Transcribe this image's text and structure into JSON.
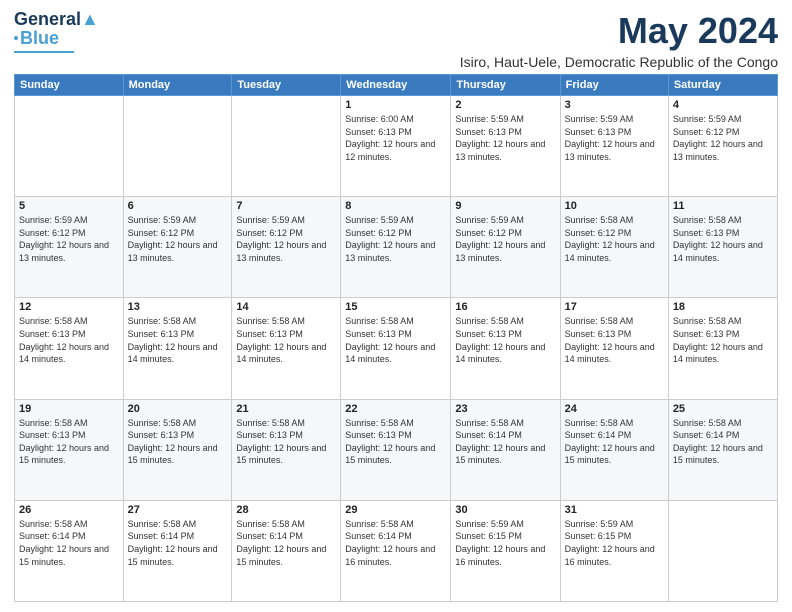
{
  "logo": {
    "line1": "General",
    "line2": "Blue"
  },
  "title": "May 2024",
  "subtitle": "Isiro, Haut-Uele, Democratic Republic of the Congo",
  "days_header": [
    "Sunday",
    "Monday",
    "Tuesday",
    "Wednesday",
    "Thursday",
    "Friday",
    "Saturday"
  ],
  "weeks": [
    [
      {
        "day": "",
        "info": ""
      },
      {
        "day": "",
        "info": ""
      },
      {
        "day": "",
        "info": ""
      },
      {
        "day": "1",
        "info": "Sunrise: 6:00 AM\nSunset: 6:13 PM\nDaylight: 12 hours\nand 12 minutes."
      },
      {
        "day": "2",
        "info": "Sunrise: 5:59 AM\nSunset: 6:13 PM\nDaylight: 12 hours\nand 13 minutes."
      },
      {
        "day": "3",
        "info": "Sunrise: 5:59 AM\nSunset: 6:13 PM\nDaylight: 12 hours\nand 13 minutes."
      },
      {
        "day": "4",
        "info": "Sunrise: 5:59 AM\nSunset: 6:12 PM\nDaylight: 12 hours\nand 13 minutes."
      }
    ],
    [
      {
        "day": "5",
        "info": "Sunrise: 5:59 AM\nSunset: 6:12 PM\nDaylight: 12 hours\nand 13 minutes."
      },
      {
        "day": "6",
        "info": "Sunrise: 5:59 AM\nSunset: 6:12 PM\nDaylight: 12 hours\nand 13 minutes."
      },
      {
        "day": "7",
        "info": "Sunrise: 5:59 AM\nSunset: 6:12 PM\nDaylight: 12 hours\nand 13 minutes."
      },
      {
        "day": "8",
        "info": "Sunrise: 5:59 AM\nSunset: 6:12 PM\nDaylight: 12 hours\nand 13 minutes."
      },
      {
        "day": "9",
        "info": "Sunrise: 5:59 AM\nSunset: 6:12 PM\nDaylight: 12 hours\nand 13 minutes."
      },
      {
        "day": "10",
        "info": "Sunrise: 5:58 AM\nSunset: 6:12 PM\nDaylight: 12 hours\nand 14 minutes."
      },
      {
        "day": "11",
        "info": "Sunrise: 5:58 AM\nSunset: 6:13 PM\nDaylight: 12 hours\nand 14 minutes."
      }
    ],
    [
      {
        "day": "12",
        "info": "Sunrise: 5:58 AM\nSunset: 6:13 PM\nDaylight: 12 hours\nand 14 minutes."
      },
      {
        "day": "13",
        "info": "Sunrise: 5:58 AM\nSunset: 6:13 PM\nDaylight: 12 hours\nand 14 minutes."
      },
      {
        "day": "14",
        "info": "Sunrise: 5:58 AM\nSunset: 6:13 PM\nDaylight: 12 hours\nand 14 minutes."
      },
      {
        "day": "15",
        "info": "Sunrise: 5:58 AM\nSunset: 6:13 PM\nDaylight: 12 hours\nand 14 minutes."
      },
      {
        "day": "16",
        "info": "Sunrise: 5:58 AM\nSunset: 6:13 PM\nDaylight: 12 hours\nand 14 minutes."
      },
      {
        "day": "17",
        "info": "Sunrise: 5:58 AM\nSunset: 6:13 PM\nDaylight: 12 hours\nand 14 minutes."
      },
      {
        "day": "18",
        "info": "Sunrise: 5:58 AM\nSunset: 6:13 PM\nDaylight: 12 hours\nand 14 minutes."
      }
    ],
    [
      {
        "day": "19",
        "info": "Sunrise: 5:58 AM\nSunset: 6:13 PM\nDaylight: 12 hours\nand 15 minutes."
      },
      {
        "day": "20",
        "info": "Sunrise: 5:58 AM\nSunset: 6:13 PM\nDaylight: 12 hours\nand 15 minutes."
      },
      {
        "day": "21",
        "info": "Sunrise: 5:58 AM\nSunset: 6:13 PM\nDaylight: 12 hours\nand 15 minutes."
      },
      {
        "day": "22",
        "info": "Sunrise: 5:58 AM\nSunset: 6:13 PM\nDaylight: 12 hours\nand 15 minutes."
      },
      {
        "day": "23",
        "info": "Sunrise: 5:58 AM\nSunset: 6:14 PM\nDaylight: 12 hours\nand 15 minutes."
      },
      {
        "day": "24",
        "info": "Sunrise: 5:58 AM\nSunset: 6:14 PM\nDaylight: 12 hours\nand 15 minutes."
      },
      {
        "day": "25",
        "info": "Sunrise: 5:58 AM\nSunset: 6:14 PM\nDaylight: 12 hours\nand 15 minutes."
      }
    ],
    [
      {
        "day": "26",
        "info": "Sunrise: 5:58 AM\nSunset: 6:14 PM\nDaylight: 12 hours\nand 15 minutes."
      },
      {
        "day": "27",
        "info": "Sunrise: 5:58 AM\nSunset: 6:14 PM\nDaylight: 12 hours\nand 15 minutes."
      },
      {
        "day": "28",
        "info": "Sunrise: 5:58 AM\nSunset: 6:14 PM\nDaylight: 12 hours\nand 15 minutes."
      },
      {
        "day": "29",
        "info": "Sunrise: 5:58 AM\nSunset: 6:14 PM\nDaylight: 12 hours\nand 16 minutes."
      },
      {
        "day": "30",
        "info": "Sunrise: 5:59 AM\nSunset: 6:15 PM\nDaylight: 12 hours\nand 16 minutes."
      },
      {
        "day": "31",
        "info": "Sunrise: 5:59 AM\nSunset: 6:15 PM\nDaylight: 12 hours\nand 16 minutes."
      },
      {
        "day": "",
        "info": ""
      }
    ]
  ]
}
